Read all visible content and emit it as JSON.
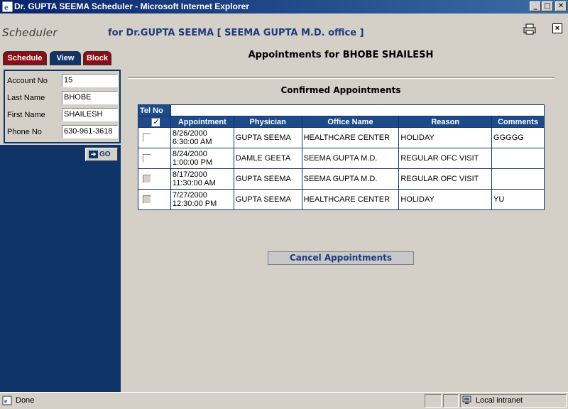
{
  "window": {
    "title": "Dr. GUPTA SEEMA Scheduler - Microsoft Internet Explorer",
    "minimize": "_",
    "maximize": "□",
    "close": "✕"
  },
  "header": {
    "app_name": "Scheduler",
    "subtitle": "for Dr.GUPTA SEEMA [ SEEMA GUPTA M.D. office ]",
    "close_glyph": "×"
  },
  "sidebar": {
    "tabs": [
      {
        "label": "Schedule"
      },
      {
        "label": "View"
      },
      {
        "label": "Block"
      }
    ],
    "fields": [
      {
        "label": "Account No",
        "value": "15"
      },
      {
        "label": "Last Name",
        "value": "BHOBE"
      },
      {
        "label": "First Name",
        "value": "SHAILESH"
      },
      {
        "label": "Phone No",
        "value": "630-961-3618"
      }
    ],
    "go_label": "GO",
    "go_arrow": "➔"
  },
  "main": {
    "title": "Appointments for BHOBE SHAILESH",
    "subtitle": "Confirmed Appointments",
    "telno_label": "Tel No",
    "columns": [
      "Appointment",
      "Physician",
      "Office Name",
      "Reason",
      "Comments"
    ],
    "rows": [
      {
        "date": "8/26/2000",
        "time": "6:30:00 AM",
        "physician": "GUPTA SEEMA",
        "office": "HEALTHCARE CENTER",
        "reason": "HOLIDAY",
        "comments": "GGGGG"
      },
      {
        "date": "8/24/2000",
        "time": "1:00:00 PM",
        "physician": "DAMLE GEETA",
        "office": "SEEMA GUPTA M.D.",
        "reason": "REGULAR OFC VISIT",
        "comments": ""
      },
      {
        "date": "8/17/2000",
        "time": "11:30:00 AM",
        "physician": "GUPTA SEEMA",
        "office": "SEEMA GUPTA M.D.",
        "reason": "REGULAR OFC VISIT",
        "comments": ""
      },
      {
        "date": "7/27/2000",
        "time": "12:30:00 PM",
        "physician": "GUPTA SEEMA",
        "office": "HEALTHCARE CENTER",
        "reason": "HOLIDAY",
        "comments": "YU"
      }
    ],
    "cancel_label": "Cancel Appointments"
  },
  "statusbar": {
    "status": "Done",
    "zone": "Local intranet"
  },
  "colors": {
    "navy": "#0e3468",
    "tab_red": "#8b0d16",
    "header_blue": "#1c4a8a"
  }
}
